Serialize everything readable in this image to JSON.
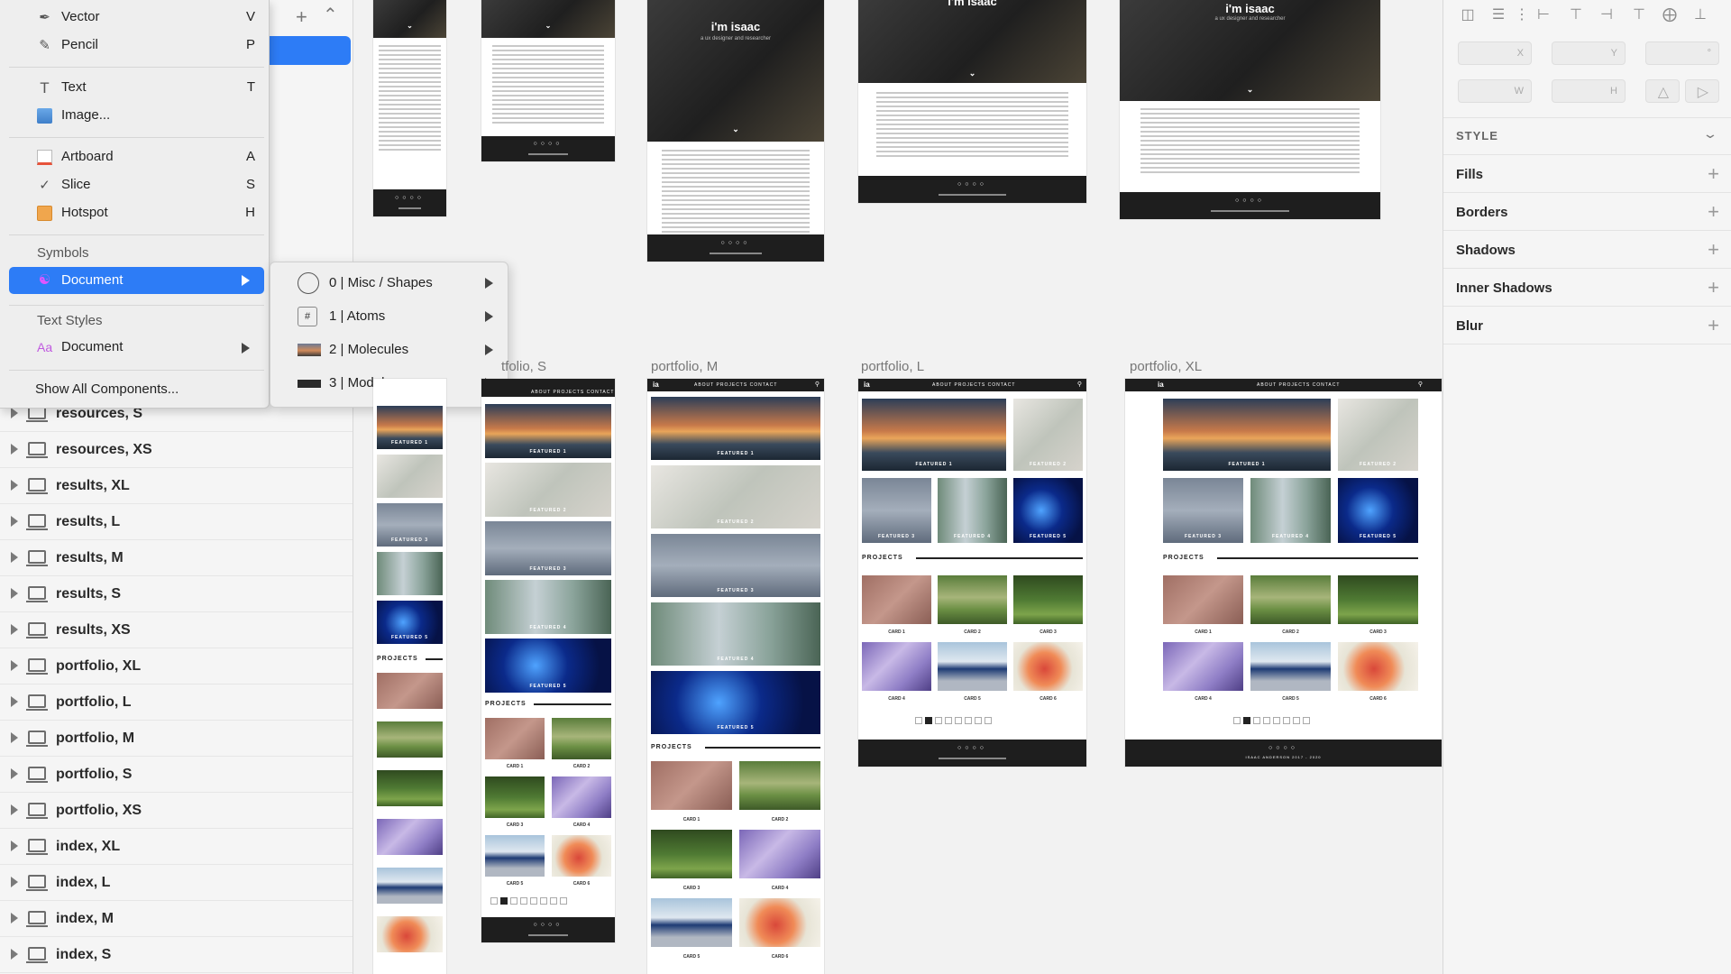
{
  "insert_menu": {
    "items": [
      {
        "label": "Vector",
        "shortcut": "V",
        "icon": "vector-pen-icon"
      },
      {
        "label": "Pencil",
        "shortcut": "P",
        "icon": "pencil-icon"
      },
      {
        "label": "Text",
        "shortcut": "T",
        "icon": "text-icon"
      },
      {
        "label": "Image...",
        "shortcut": "",
        "icon": "image-icon"
      },
      {
        "label": "Artboard",
        "shortcut": "A",
        "icon": "artboard-icon"
      },
      {
        "label": "Slice",
        "shortcut": "S",
        "icon": "slice-icon"
      },
      {
        "label": "Hotspot",
        "shortcut": "H",
        "icon": "hotspot-icon"
      }
    ],
    "symbols_header": "Symbols",
    "symbols_document": "Document",
    "text_styles_header": "Text Styles",
    "text_styles_document": "Document",
    "show_all": "Show All Components..."
  },
  "submenu": {
    "items": [
      {
        "label": "0 | Misc / Shapes"
      },
      {
        "label": "1 | Atoms"
      },
      {
        "label": "2 | Molecules"
      },
      {
        "label": "3 | Modules"
      }
    ]
  },
  "layers": [
    "resources, S",
    "resources, XS",
    "results, XL",
    "results, L",
    "results, M",
    "results, S",
    "results, XS",
    "portfolio, XL",
    "portfolio, L",
    "portfolio, M",
    "portfolio, S",
    "portfolio, XS",
    "index, XL",
    "index, L",
    "index, M",
    "index, S"
  ],
  "canvas": {
    "labels": {
      "s": "tfolio, S",
      "m": "portfolio, M",
      "l": "portfolio, L",
      "xl": "portfolio, XL"
    },
    "hero_title": "i'm isaac",
    "hero_sub": "a ux designer and researcher",
    "nav_logo": "ia",
    "nav_links": "ABOUT   PROJECTS   CONTACT",
    "projects": "PROJECTS",
    "footer": "ISAAC ANDERSON 2017 - 2020",
    "featured": [
      "FEATURED 1",
      "FEATURED 2",
      "FEATURED 3",
      "FEATURED 4",
      "FEATURED 5"
    ],
    "cards": [
      "CARD 1",
      "CARD 2",
      "CARD 3",
      "CARD 4",
      "CARD 5",
      "CARD 6"
    ]
  },
  "inspector": {
    "x": "X",
    "y": "Y",
    "w": "W",
    "h": "H",
    "deg": "°",
    "style": "STYLE",
    "sections": [
      "Fills",
      "Borders",
      "Shadows",
      "Inner Shadows",
      "Blur"
    ]
  }
}
